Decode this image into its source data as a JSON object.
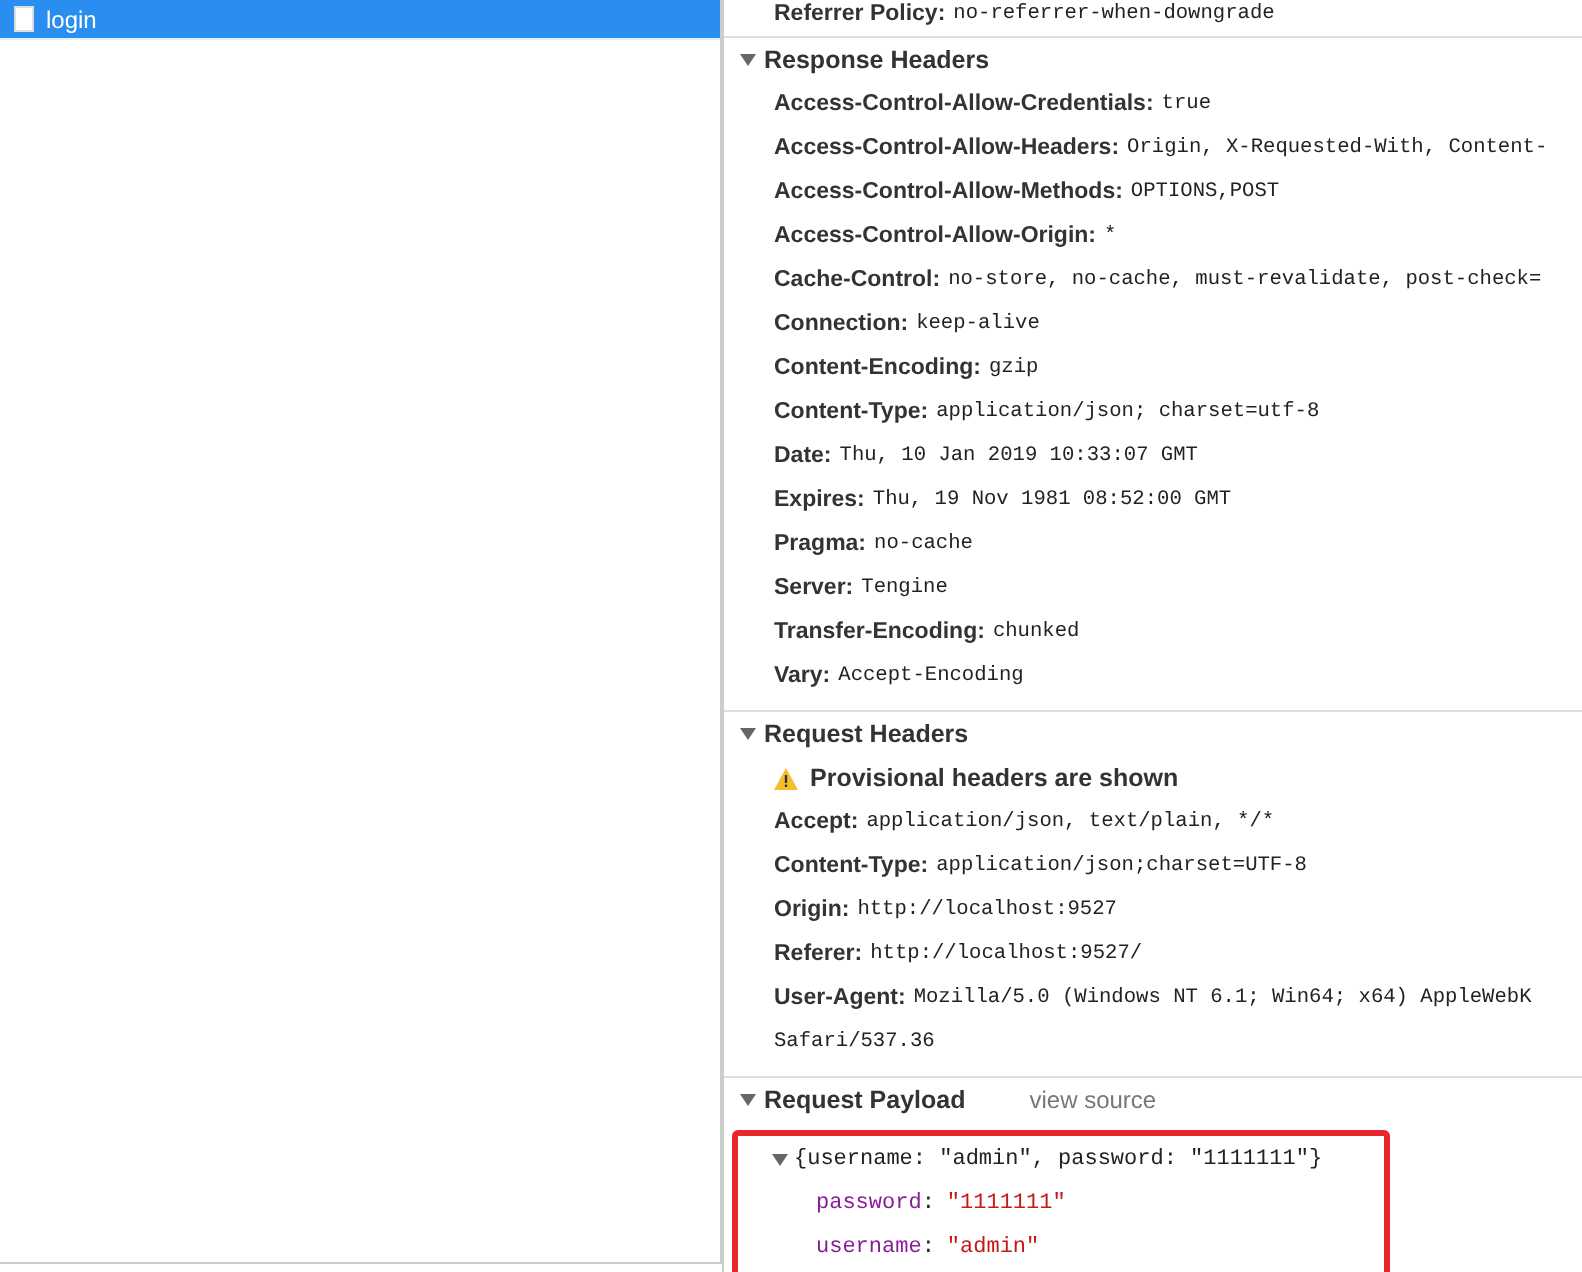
{
  "requests": [
    {
      "name": "login",
      "selected": true
    }
  ],
  "general_tail": {
    "key": "Referrer Policy:",
    "value": "no-referrer-when-downgrade"
  },
  "sections": [
    {
      "title": "Response Headers",
      "expanded": true,
      "kind": "headers",
      "rows": [
        {
          "key": "Access-Control-Allow-Credentials:",
          "value": "true"
        },
        {
          "key": "Access-Control-Allow-Headers:",
          "value": "Origin, X-Requested-With, Content-"
        },
        {
          "key": "Access-Control-Allow-Methods:",
          "value": "OPTIONS,POST"
        },
        {
          "key": "Access-Control-Allow-Origin:",
          "value": "*"
        },
        {
          "key": "Cache-Control:",
          "value": "no-store, no-cache, must-revalidate, post-check="
        },
        {
          "key": "Connection:",
          "value": "keep-alive"
        },
        {
          "key": "Content-Encoding:",
          "value": "gzip"
        },
        {
          "key": "Content-Type:",
          "value": "application/json; charset=utf-8"
        },
        {
          "key": "Date:",
          "value": "Thu, 10 Jan 2019 10:33:07 GMT"
        },
        {
          "key": "Expires:",
          "value": "Thu, 19 Nov 1981 08:52:00 GMT"
        },
        {
          "key": "Pragma:",
          "value": "no-cache"
        },
        {
          "key": "Server:",
          "value": "Tengine"
        },
        {
          "key": "Transfer-Encoding:",
          "value": "chunked"
        },
        {
          "key": "Vary:",
          "value": "Accept-Encoding"
        }
      ]
    },
    {
      "title": "Request Headers",
      "expanded": true,
      "kind": "headers",
      "warning": "Provisional headers are shown",
      "rows": [
        {
          "key": "Accept:",
          "value": "application/json, text/plain, */*"
        },
        {
          "key": "Content-Type:",
          "value": "application/json;charset=UTF-8"
        },
        {
          "key": "Origin:",
          "value": "http://localhost:9527"
        },
        {
          "key": "Referer:",
          "value": "http://localhost:9527/"
        },
        {
          "key": "User-Agent:",
          "value": "Mozilla/5.0 (Windows NT 6.1; Win64; x64) AppleWebK",
          "continuation": "Safari/537.36"
        }
      ]
    },
    {
      "title": "Request Payload",
      "expanded": true,
      "kind": "payload",
      "link": "view source",
      "highlighted": true,
      "summary": "{username: \"admin\", password: \"1111111\"}",
      "summary_expanded": true,
      "rows": [
        {
          "key": "password",
          "separator": ":",
          "value": "\"1111111\""
        },
        {
          "key": "username",
          "separator": ":",
          "value": "\"admin\""
        }
      ]
    }
  ]
}
